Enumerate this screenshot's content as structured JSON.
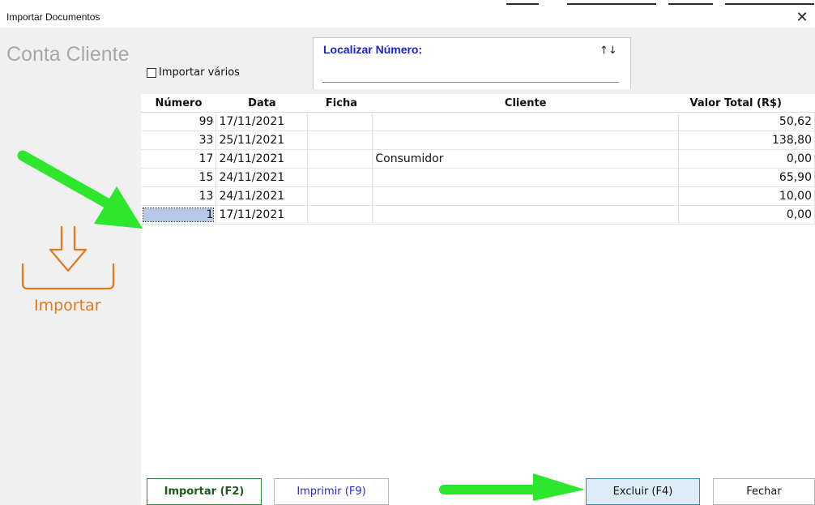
{
  "window": {
    "title": "Importar Documentos"
  },
  "left": {
    "heading": "Conta Cliente",
    "import_label": "Importar"
  },
  "options": {
    "importar_varios": "Importar vários"
  },
  "search": {
    "label": "Localizar Número:",
    "value": ""
  },
  "table": {
    "headers": {
      "numero": "Número",
      "data": "Data",
      "ficha": "Ficha",
      "cliente": "Cliente",
      "valor": "Valor Total (R$)"
    },
    "rows": [
      {
        "numero": "99",
        "data": "17/11/2021",
        "ficha": "",
        "cliente": "",
        "valor": "50,62"
      },
      {
        "numero": "33",
        "data": "25/11/2021",
        "ficha": "",
        "cliente": "",
        "valor": "138,80"
      },
      {
        "numero": "17",
        "data": "24/11/2021",
        "ficha": "",
        "cliente": "Consumidor",
        "valor": "0,00"
      },
      {
        "numero": "15",
        "data": "24/11/2021",
        "ficha": "",
        "cliente": "",
        "valor": "65,90"
      },
      {
        "numero": "13",
        "data": "24/11/2021",
        "ficha": "",
        "cliente": "",
        "valor": "10,00"
      },
      {
        "numero": "1",
        "data": "17/11/2021",
        "ficha": "",
        "cliente": "",
        "valor": "0,00"
      }
    ],
    "selected_row": 5
  },
  "buttons": {
    "importar": "Importar (F2)",
    "imprimir": "Imprimir (F9)",
    "excluir": "Excluir (F4)",
    "fechar": "Fechar"
  },
  "colors": {
    "accent_orange": "#e07a20",
    "search_label_blue": "#1a22d6",
    "annotation_green": "#2de62d",
    "selected_cell": "#b8c8e8"
  }
}
